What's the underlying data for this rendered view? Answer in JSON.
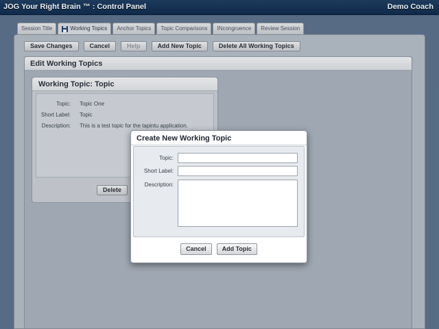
{
  "app": {
    "title": "JOG Your Right Brain ™ : Control Panel",
    "user": "Demo Coach"
  },
  "tabs": [
    {
      "label": "Session Title",
      "active": false
    },
    {
      "label": "Working Topics",
      "active": true,
      "icon": "disk-icon"
    },
    {
      "label": "Anchor Topics",
      "active": false
    },
    {
      "label": "Topic Comparisons",
      "active": false
    },
    {
      "label": "INcongruence",
      "active": false
    },
    {
      "label": "Review Session",
      "active": false
    }
  ],
  "toolbar": {
    "save_changes": "Save Changes",
    "cancel": "Cancel",
    "help": "Help",
    "add_new_topic": "Add New Topic",
    "delete_all": "Delete All Working Topics"
  },
  "section": {
    "title": "Edit Working Topics"
  },
  "card": {
    "title": "Working Topic: Topic",
    "fields": [
      {
        "label": "Topic:",
        "value": "Topic One"
      },
      {
        "label": "Short Label:",
        "value": "Topic"
      },
      {
        "label": "Description:",
        "value": "This is a test topic for the tapintu application."
      }
    ],
    "delete": "Delete"
  },
  "modal": {
    "title": "Create New Working Topic",
    "topic_label": "Topic:",
    "topic_value": "",
    "short_label_label": "Short Label:",
    "short_label_value": "",
    "description_label": "Description:",
    "description_value": "",
    "cancel": "Cancel",
    "add_topic": "Add Topic"
  },
  "colors": {
    "titlebar": "#0f2a4a",
    "background": "#5f7590",
    "panel": "#bcc4cc"
  }
}
